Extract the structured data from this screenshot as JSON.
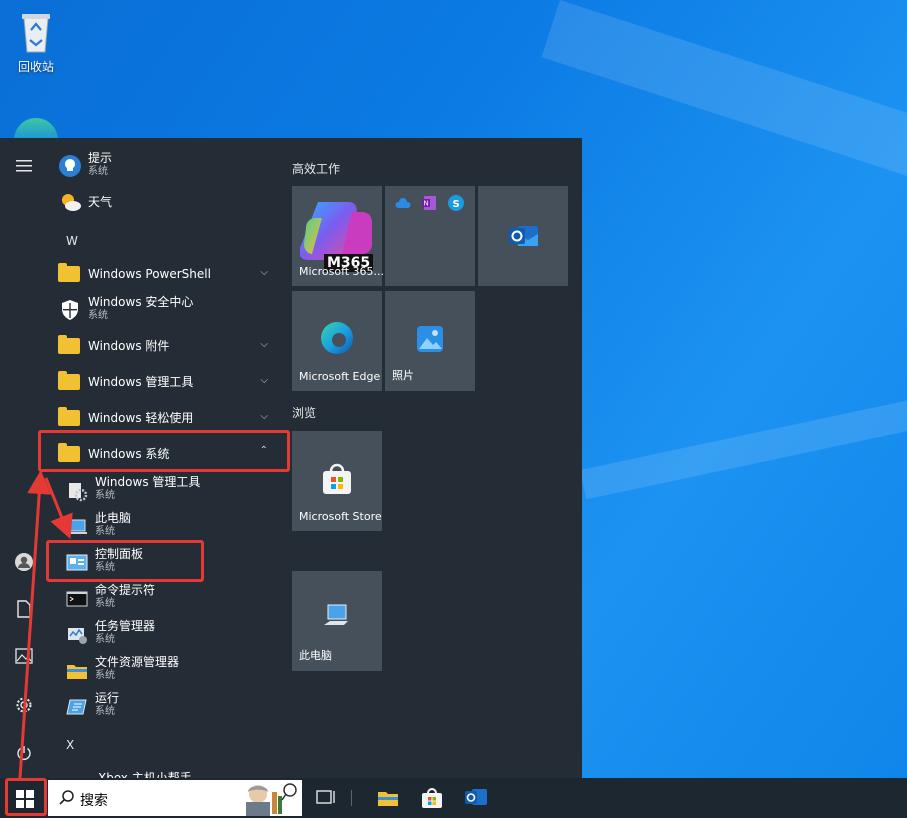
{
  "desktop": {
    "recycle_bin_label": "回收站"
  },
  "start_menu": {
    "rail_icons": [
      "hamburger-icon",
      "user-icon",
      "document-icon",
      "pictures-icon",
      "settings-icon",
      "power-icon"
    ],
    "apps": {
      "tips": {
        "name": "提示",
        "sub": "系统"
      },
      "weather": {
        "name": "天气"
      },
      "letter_w": "W",
      "powershell": {
        "name": "Windows PowerShell"
      },
      "security": {
        "name": "Windows 安全中心",
        "sub": "系统"
      },
      "accessories": {
        "name": "Windows 附件"
      },
      "admin_tools": {
        "name": "Windows 管理工具"
      },
      "ease": {
        "name": "Windows 轻松使用"
      },
      "system": {
        "name": "Windows 系统"
      },
      "system_items": [
        {
          "name": "Windows 管理工具",
          "sub": "系统"
        },
        {
          "name": "此电脑",
          "sub": "系统"
        },
        {
          "name": "控制面板",
          "sub": "系统"
        },
        {
          "name": "命令提示符",
          "sub": "系统"
        },
        {
          "name": "任务管理器",
          "sub": "系统"
        },
        {
          "name": "文件资源管理器",
          "sub": "系统"
        },
        {
          "name": "运行",
          "sub": "系统"
        }
      ],
      "letter_x": "X",
      "xbox_partial": "Xbox 主机小帮手"
    },
    "tiles": {
      "group1": "高效工作",
      "m365": {
        "label": "Microsoft 365...",
        "badge": "M365"
      },
      "edge": {
        "label": "Microsoft Edge"
      },
      "photos": {
        "label": "照片"
      },
      "group2": "浏览",
      "store": {
        "label": "Microsoft Store"
      },
      "thispc": {
        "label": "此电脑"
      }
    }
  },
  "taskbar": {
    "search_text": "搜索"
  },
  "colors": {
    "start_bg": "#242d35",
    "tile_bg": "#46505a",
    "taskbar_bg": "#1d2730",
    "highlight": "#e53935",
    "desktop_blue": "#0b7ae3"
  }
}
